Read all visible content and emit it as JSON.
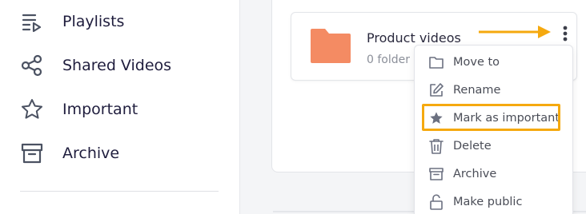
{
  "sidebar": {
    "items": [
      {
        "label": "Playlists",
        "icon": "playlist-icon"
      },
      {
        "label": "Shared Videos",
        "icon": "share-icon"
      },
      {
        "label": "Important",
        "icon": "star-icon"
      },
      {
        "label": "Archive",
        "icon": "archive-icon"
      }
    ]
  },
  "folder": {
    "title": "Product videos",
    "subtitle": "0 folder",
    "color": "#f48b63"
  },
  "menu": {
    "items": [
      {
        "label": "Move to",
        "icon": "folder-outline-icon"
      },
      {
        "label": "Rename",
        "icon": "edit-icon"
      },
      {
        "label": "Mark as important",
        "icon": "star-filled-icon"
      },
      {
        "label": "Delete",
        "icon": "trash-icon"
      },
      {
        "label": "Archive",
        "icon": "archive-icon"
      },
      {
        "label": "Make public",
        "icon": "unlock-icon"
      }
    ]
  },
  "colors": {
    "accent": "#f5a90f",
    "folder": "#f48b63",
    "text_dark": "#1f1d3d",
    "icon_gray": "#5b6070"
  }
}
